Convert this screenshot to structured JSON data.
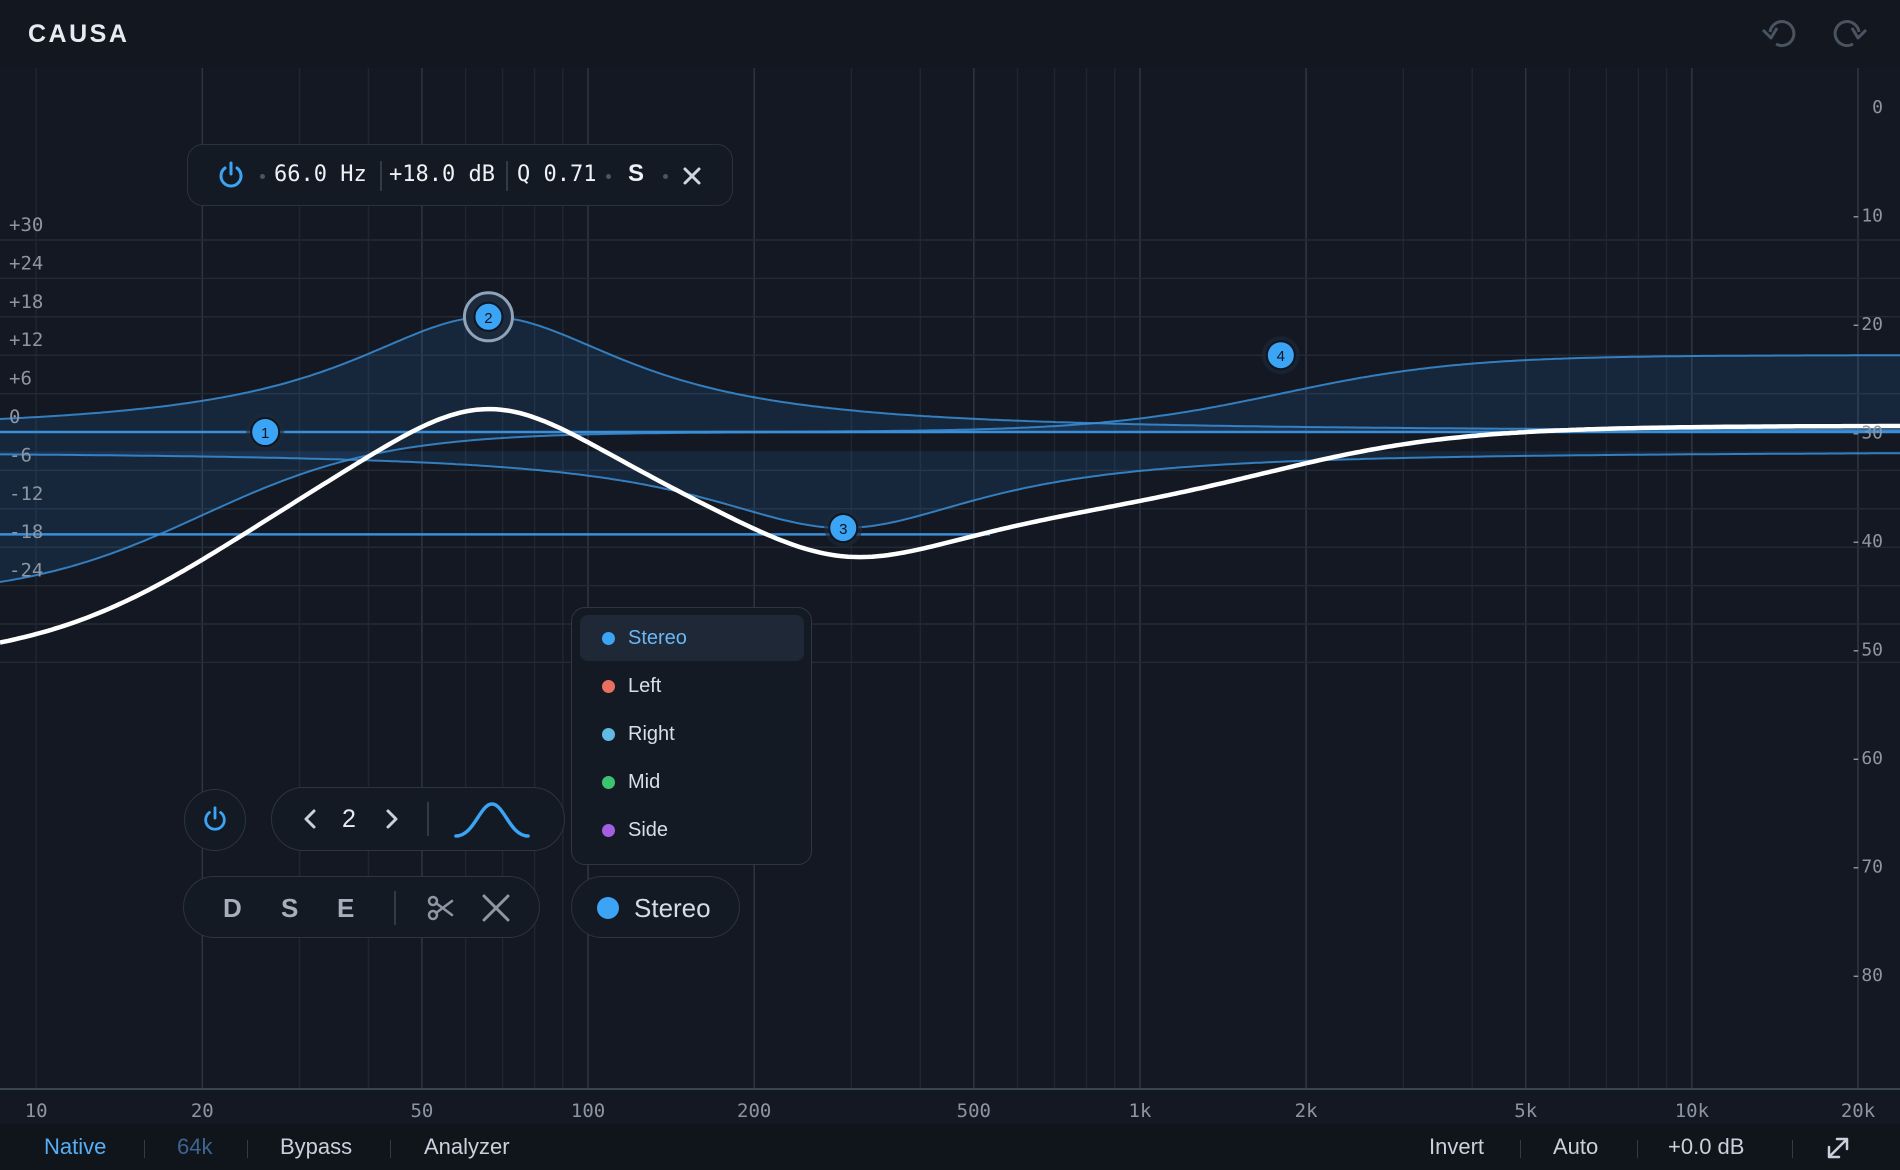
{
  "app": {
    "title": "CAUSA"
  },
  "toolbar": {
    "undo_icon": "undo-icon",
    "redo_icon": "redo-icon"
  },
  "eq": {
    "x_ticks": [
      "10",
      "20",
      "50",
      "100",
      "200",
      "500",
      "1k",
      "2k",
      "5k",
      "10k",
      "20k"
    ],
    "y_ticks_left": [
      "+30",
      "+24",
      "+18",
      "+12",
      "+6",
      "0",
      "-6",
      "-12",
      "-18",
      "-24"
    ],
    "y_ticks_right": [
      "0",
      "-10",
      "-20",
      "-30",
      "-40",
      "-50",
      "-60",
      "-70",
      "-80"
    ],
    "bands": [
      {
        "label": "1",
        "freq_hz": 26,
        "gain_db": 0
      },
      {
        "label": "2",
        "freq_hz": 66,
        "gain_db": 18,
        "q": 0.71,
        "selected": true
      },
      {
        "label": "3",
        "freq_hz": 290,
        "gain_db": -15
      },
      {
        "label": "4",
        "freq_hz": 1800,
        "gain_db": 12
      }
    ]
  },
  "band_popup": {
    "power_icon": "power-icon",
    "freq": "66.0 Hz",
    "gain": "+18.0 dB",
    "q": "Q 0.71",
    "mode": "S",
    "close_icon": "close-icon"
  },
  "band_controls": {
    "power_icon": "power-icon",
    "band_number": "2",
    "prev_icon": "chevron-left-icon",
    "next_icon": "chevron-right-icon",
    "shape_icon": "bell-shape-icon",
    "d_label": "D",
    "s_label": "S",
    "e_label": "E",
    "scissors_icon": "scissors-icon",
    "delete_icon": "close-icon",
    "channel_label": "Stereo"
  },
  "channel_menu": {
    "items": [
      {
        "label": "Stereo",
        "color": "#3ba4f5",
        "selected": true
      },
      {
        "label": "Left",
        "color": "#e8705f"
      },
      {
        "label": "Right",
        "color": "#62b9e6"
      },
      {
        "label": "Mid",
        "color": "#3dc270"
      },
      {
        "label": "Side",
        "color": "#a35ee2"
      }
    ]
  },
  "bottom_bar": {
    "native": "Native",
    "rate": "64k",
    "bypass": "Bypass",
    "analyzer": "Analyzer",
    "invert": "Invert",
    "auto": "Auto",
    "output_gain": "+0.0 dB",
    "expand_icon": "expand-icon"
  },
  "colors": {
    "accent": "#3ba4f5",
    "background": "#131821",
    "curve": "#ffffff"
  }
}
